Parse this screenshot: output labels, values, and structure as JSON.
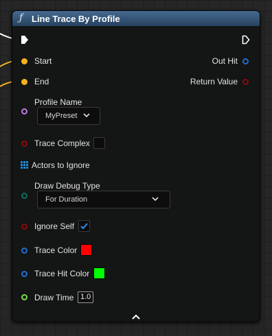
{
  "node": {
    "function_icon": "ƒ",
    "title": "Line Trace By Profile",
    "header_color": "#3d6186",
    "inputs": {
      "start": "Start",
      "end": "End",
      "profile_name": "Profile Name",
      "profile_name_value": "MyPreset",
      "trace_complex": "Trace Complex",
      "trace_complex_checked": false,
      "actors_to_ignore": "Actors to Ignore",
      "draw_debug_type": "Draw Debug Type",
      "draw_debug_type_value": "For Duration",
      "ignore_self": "Ignore Self",
      "ignore_self_checked": true,
      "trace_color": "Trace Color",
      "trace_color_value": "#ff0000",
      "trace_hit_color": "Trace Hit Color",
      "trace_hit_color_value": "#00ff00",
      "draw_time": "Draw Time",
      "draw_time_value": "1.0"
    },
    "outputs": {
      "out_hit": "Out Hit",
      "return_value": "Return Value"
    },
    "icons": {
      "exec_in": "exec-arrow-filled",
      "exec_out": "exec-arrow-outline",
      "collapse": "chevron-up"
    }
  },
  "pin_colors": {
    "vector": "#f5b31c",
    "struct": "#1f6fd6",
    "bool": "#8c0a0a",
    "name": "#c37ce4",
    "array": "#1d8ad6",
    "enum": "#0f6e63",
    "color": "#1f6fd6",
    "float": "#7be04a"
  }
}
